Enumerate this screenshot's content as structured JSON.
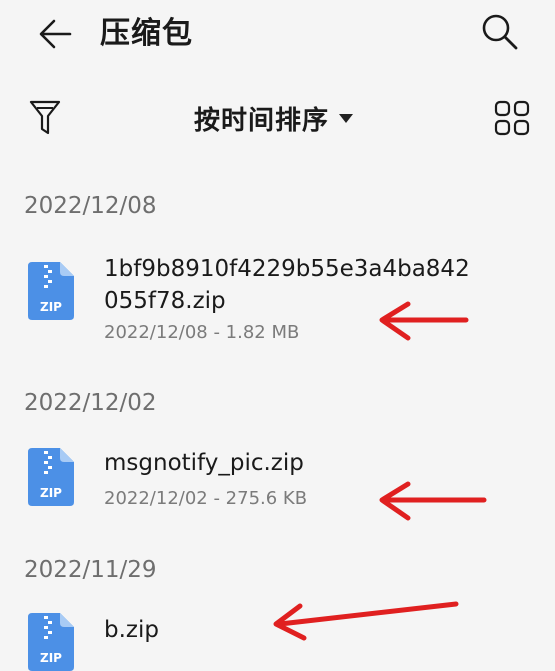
{
  "header": {
    "title": "压缩包",
    "back_icon": "arrow-left-icon",
    "search_icon": "search-icon"
  },
  "toolbar": {
    "filter_icon": "filter-icon",
    "sort_label": "按时间排序",
    "view_icon": "grid-view-icon"
  },
  "groups": [
    {
      "date": "2022/12/08",
      "file": {
        "name_line1": "1bf9b8910f4229b55e3a4ba842",
        "name_line2": "055f78.zip",
        "meta": "2022/12/08 - 1.82 MB",
        "icon_label": "ZIP"
      }
    },
    {
      "date": "2022/12/02",
      "file": {
        "name": "msgnotify_pic.zip",
        "meta": "2022/12/02 - 275.6 KB",
        "icon_label": "ZIP"
      }
    },
    {
      "date": "2022/11/29",
      "file": {
        "name": "b.zip",
        "icon_label": "ZIP"
      }
    }
  ],
  "colors": {
    "zip_icon": "#4c90e6",
    "zip_icon_fold": "#a8cbf5",
    "annotation_arrow": "#e02020"
  }
}
